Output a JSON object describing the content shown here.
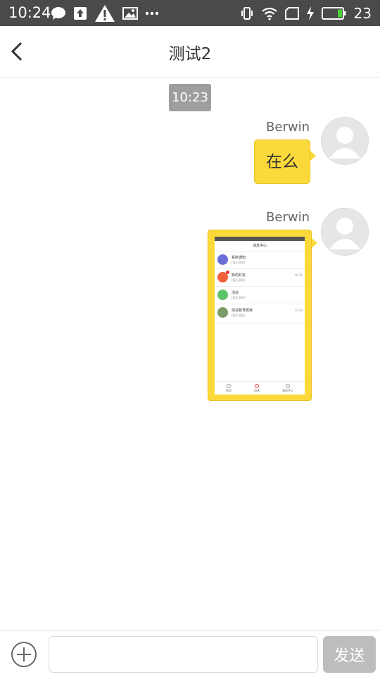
{
  "status_bar": {
    "time": "10:24",
    "battery_percent": "23",
    "battery_level": 0.23,
    "icons_left": [
      "message-bubble-icon",
      "upload-icon",
      "warning-icon",
      "image-icon",
      "more-dots-icon"
    ],
    "icons_right": [
      "vibrate-icon",
      "wifi-icon",
      "sim-icon",
      "charging-icon",
      "battery-icon"
    ]
  },
  "header": {
    "title": "测试2"
  },
  "chat": {
    "timestamp": "10:23",
    "messages": [
      {
        "sender": "Berwin",
        "type": "text",
        "text": "在么"
      },
      {
        "sender": "Berwin",
        "type": "image",
        "image_description": "screenshot"
      }
    ],
    "thumbnail": {
      "title": "消息中心",
      "rows": [
        {
          "title": "系统通知",
          "subtitle": "[暂无消息]",
          "time": "",
          "icon_color": "#6a6fd8"
        },
        {
          "title": "新的好友",
          "subtitle": "[暂无消息]",
          "time": "16:21",
          "icon_color": "#f0603a"
        },
        {
          "title": "活动",
          "subtitle": "[暂无消息]",
          "time": "",
          "icon_color": "#5cc46a"
        },
        {
          "title": "测试账号昵称",
          "subtitle": "[图片消息]",
          "time": "15:40",
          "icon_color": "#7b9c6a"
        }
      ],
      "tabs": [
        "首页",
        "消息",
        "我的中心"
      ]
    }
  },
  "input_bar": {
    "input_value": "",
    "placeholder": "",
    "send_label": "发送"
  },
  "colors": {
    "bubble": "#fbd93a",
    "status_bar": "#4a4a4a",
    "send_disabled": "#bdbdbd"
  }
}
